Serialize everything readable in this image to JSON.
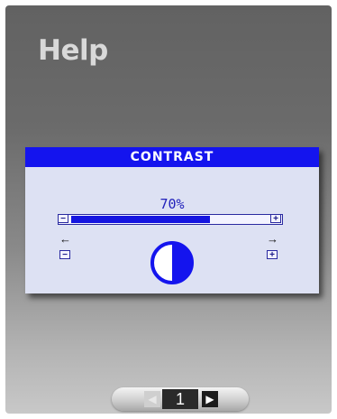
{
  "page": {
    "title": "Help"
  },
  "osd": {
    "header": "CONTRAST",
    "value_label": "70%",
    "level_fraction": 0.7,
    "minus_symbol": "−",
    "plus_symbol": "+",
    "left_arrow": "←",
    "right_arrow": "→",
    "icon": "contrast-icon"
  },
  "pager": {
    "page_number": "1",
    "prev_icon": "◀",
    "next_icon": "▶"
  },
  "colors": {
    "osd_accent": "#1414ee",
    "osd_background": "#dde1f3"
  }
}
